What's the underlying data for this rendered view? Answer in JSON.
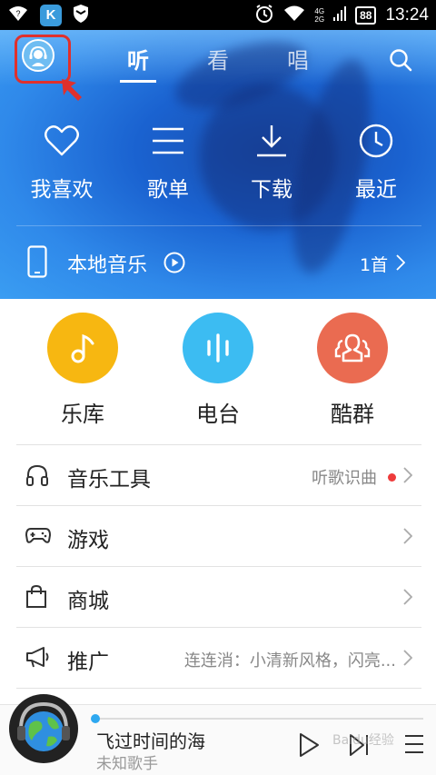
{
  "status_bar": {
    "app_badge": "K",
    "network_top": "4G",
    "network_bottom": "2G",
    "battery": "88",
    "time": "13:24"
  },
  "top_nav": {
    "tabs": [
      {
        "label": "听"
      },
      {
        "label": "看"
      },
      {
        "label": "唱"
      }
    ]
  },
  "quick_actions": [
    {
      "label": "我喜欢",
      "icon": "heart-icon"
    },
    {
      "label": "歌单",
      "icon": "list-icon"
    },
    {
      "label": "下载",
      "icon": "download-icon"
    },
    {
      "label": "最近",
      "icon": "clock-icon"
    }
  ],
  "local_music": {
    "label": "本地音乐",
    "count": "1首"
  },
  "categories": [
    {
      "label": "乐库",
      "icon": "music-note-icon",
      "color": "#f7b711"
    },
    {
      "label": "电台",
      "icon": "radio-icon",
      "color": "#3cbcf2"
    },
    {
      "label": "酷群",
      "icon": "group-icon",
      "color": "#ea6b51"
    }
  ],
  "menu": [
    {
      "title": "音乐工具",
      "right": "听歌识曲",
      "icon": "headphones-icon",
      "has_dot": true
    },
    {
      "title": "游戏",
      "right": "",
      "icon": "gamepad-icon",
      "has_dot": false
    },
    {
      "title": "商城",
      "right": "",
      "icon": "shopping-bag-icon",
      "has_dot": false
    },
    {
      "title": "推广",
      "right": "连连消：小清新风格，闪亮...",
      "icon": "megaphone-icon",
      "has_dot": false
    }
  ],
  "player": {
    "title": "飞过时间的海",
    "artist": "未知歌手",
    "progress": 0.0
  },
  "watermark": "Baidu经验",
  "colors": {
    "accent_blue": "#2ea8f0",
    "highlight_red": "#e0302c"
  }
}
